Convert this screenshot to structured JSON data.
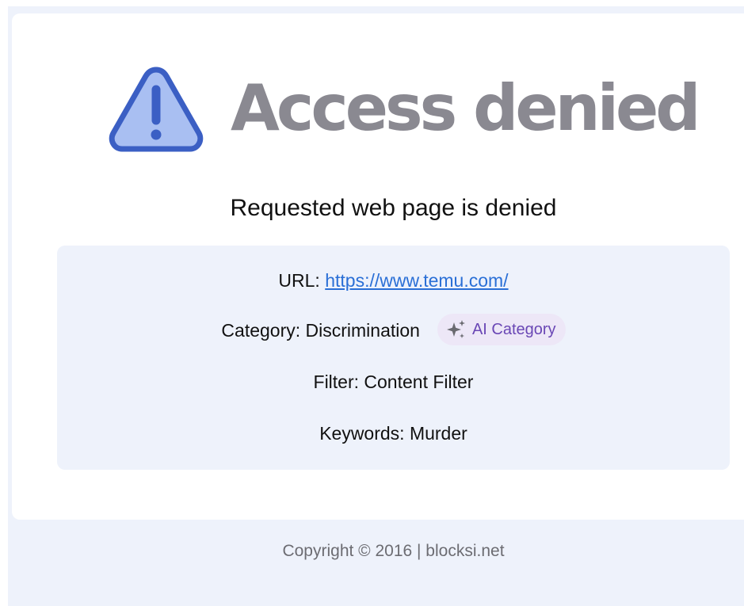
{
  "hero": {
    "title": "Access denied",
    "icon": "warning-triangle-icon"
  },
  "subtitle": "Requested web page is denied",
  "info": {
    "url_label": "URL: ",
    "url_value": "https://www.temu.com/",
    "category_label": "Category: Discrimination",
    "ai_badge_label": "AI Category",
    "ai_badge_icon": "sparkles-icon",
    "filter_label": "Filter: Content Filter",
    "keywords_label": "Keywords: Murder"
  },
  "footer": {
    "copyright": "Copyright © 2016 | blocksi.net"
  },
  "colors": {
    "page_background": "#eef2fb",
    "card_background": "#ffffff",
    "title_gray": "#8a8991",
    "link_blue": "#2a6fd6",
    "icon_blue": "#3b5fc4",
    "icon_fill": "#a9bff2",
    "badge_purple": "#6a47b5",
    "badge_background": "#ede7f7"
  }
}
